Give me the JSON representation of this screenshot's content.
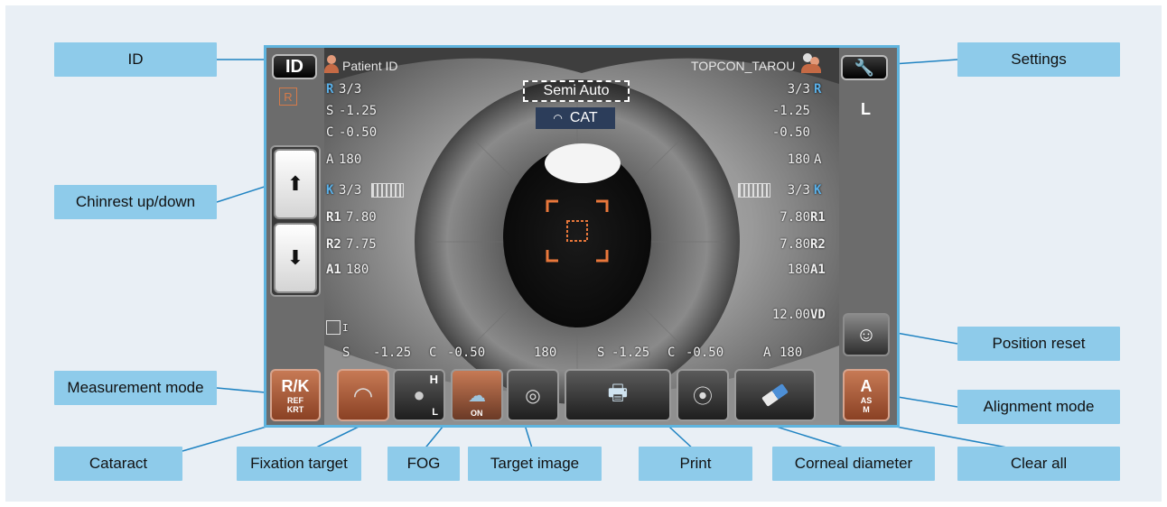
{
  "callouts": {
    "id": "ID",
    "settings": "Settings",
    "chinrest": "Chinrest up/down",
    "position_reset": "Position reset",
    "measurement_mode": "Measurement mode",
    "alignment_mode": "Alignment mode",
    "cataract": "Cataract",
    "fixation_target": "Fixation target",
    "fog": "FOG",
    "target_image": "Target image",
    "print": "Print",
    "corneal_diameter": "Corneal diameter",
    "clear_all": "Clear all"
  },
  "screen": {
    "id_button": "ID",
    "patient_id": "Patient ID",
    "operator": "TOPCON_TAROU",
    "eye_right": "R",
    "eye_left": "L",
    "mode": "Semi Auto",
    "cat_label": "CAT",
    "measurement_mode_button": {
      "main": "R/K",
      "sub1": "REF",
      "sub2": "KRT"
    },
    "alignment_mode_button": {
      "main": "A",
      "sub1": "AS",
      "sub2": "M"
    },
    "fixation_button": {
      "top": "H",
      "bottom": "L"
    },
    "fog_button": "ON",
    "left_readings": {
      "r_sd": "3/3",
      "s": "-1.25",
      "c": "-0.50",
      "a": "180",
      "k_sd": "3/3",
      "r1": "7.80",
      "r2": "7.75",
      "a1": "180"
    },
    "right_readings": {
      "r_sd": "3/3",
      "s": "-1.25",
      "c": "-0.50",
      "a": "180",
      "k_sd": "3/3",
      "r1": "7.80",
      "r2": "7.80",
      "a1": "180"
    },
    "row_labels": {
      "r": "R",
      "s": "S",
      "c": "C",
      "a": "A",
      "k": "K",
      "r1": "R1",
      "r2": "R2",
      "a1": "A1"
    },
    "vd_label": "VD",
    "vd_value": "12.00",
    "small_label": "I",
    "bottom_bar": {
      "s_label": "S",
      "s_value": "-1.25",
      "c_label": "C",
      "c_value": "-0.50",
      "a_value": "180",
      "s2_label": "S",
      "s2_value": "-1.25",
      "c2_label": "C",
      "c2_value": "-0.50",
      "a2_label": "A",
      "a2_value": "180"
    }
  },
  "colors": {
    "callout_bg": "#8ecbea",
    "frame_bg": "#e9eff5",
    "screen_border": "#5fb4de",
    "leader_line": "#1f83c2",
    "accent_orange": "#e27a3f"
  },
  "icons": [
    "wrench-icon",
    "printer-icon",
    "eraser-icon",
    "head-position-icon",
    "cataract-eye-icon",
    "fixation-target-icon",
    "fog-icon",
    "target-image-icon",
    "corneal-diameter-icon",
    "chinrest-up-icon",
    "chinrest-down-icon",
    "patient-icon",
    "operator-icon"
  ]
}
